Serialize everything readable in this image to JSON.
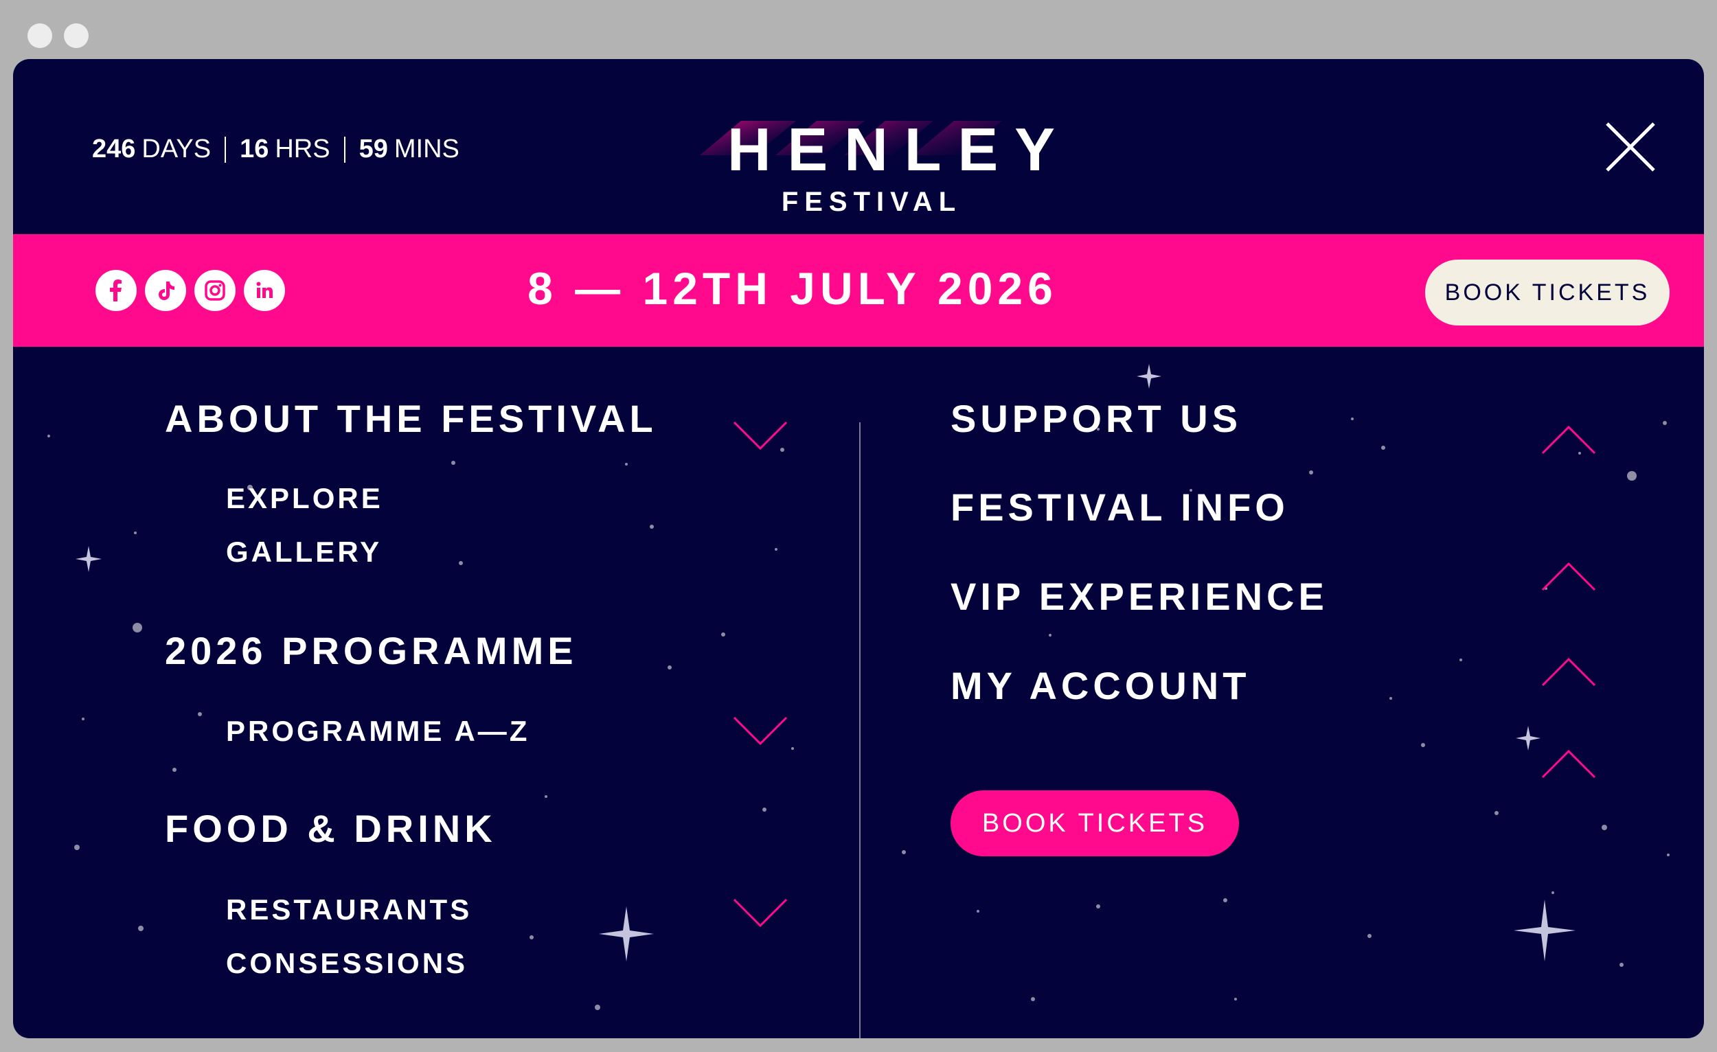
{
  "countdown": {
    "days_value": "246",
    "days_unit": "DAYS",
    "hrs_value": "16",
    "hrs_unit": "HRS",
    "mins_value": "59",
    "mins_unit": "MINS"
  },
  "logo": {
    "main": "HENLEY",
    "sub": "FESTIVAL"
  },
  "band": {
    "dates": "8 — 12TH JULY 2026",
    "book_label": "BOOK TICKETS",
    "socials": [
      "facebook-icon",
      "tiktok-icon",
      "instagram-icon",
      "linkedin-icon"
    ]
  },
  "nav_left": [
    {
      "label": "ABOUT THE FESTIVAL",
      "expanded": true,
      "items": [
        "EXPLORE",
        "GALLERY"
      ]
    },
    {
      "label": "2026 PROGRAMME",
      "expanded": true,
      "items": [
        "PROGRAMME A—Z"
      ]
    },
    {
      "label": "FOOD & DRINK",
      "expanded": true,
      "items": [
        "RESTAURANTS",
        "CONSESSIONS"
      ]
    }
  ],
  "nav_right": [
    {
      "label": "SUPPORT US",
      "expanded": false
    },
    {
      "label": "FESTIVAL INFO",
      "expanded": false
    },
    {
      "label": "VIP EXPERIENCE",
      "expanded": false
    },
    {
      "label": "MY ACCOUNT",
      "expanded": false
    }
  ],
  "book_main_label": "BOOK TICKETS",
  "colors": {
    "navy": "#03023a",
    "pink": "#ff0a8c",
    "cream": "#f4efe3",
    "frame": "#b3b3b3"
  }
}
